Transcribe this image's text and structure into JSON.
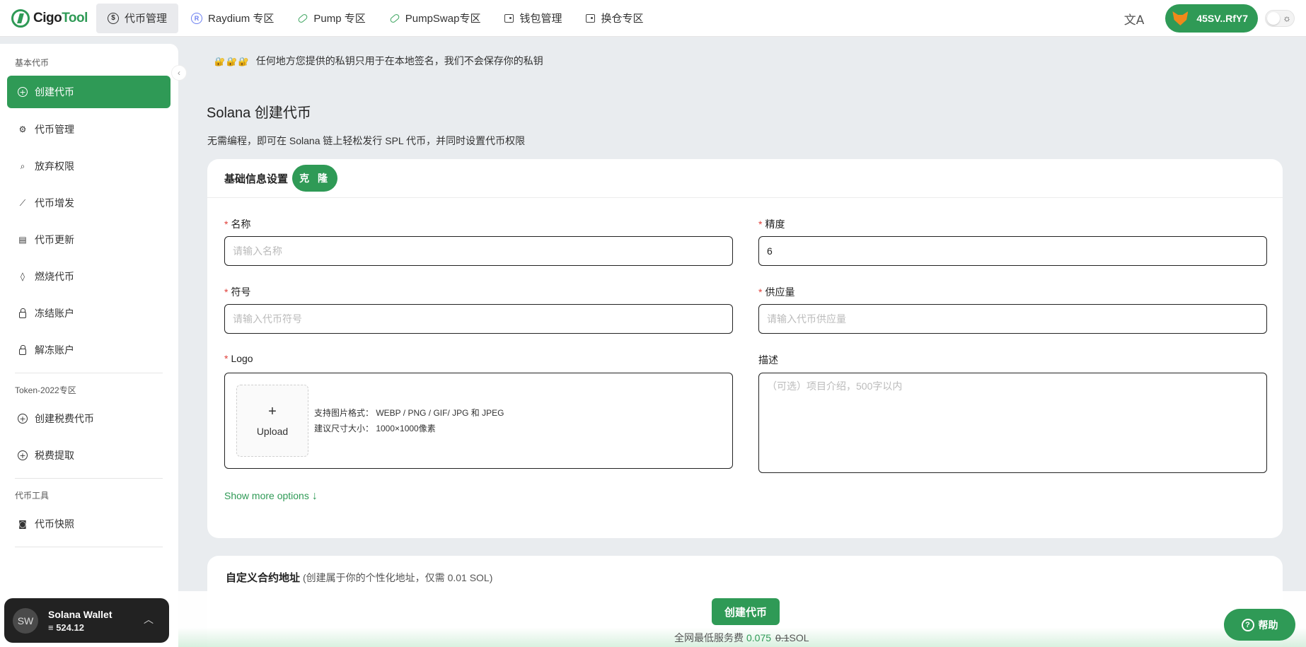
{
  "brand": {
    "name_a": "Cigo",
    "name_b": "Tool"
  },
  "nav": [
    {
      "label": "代币管理",
      "icon": "dollar-icon",
      "active": true
    },
    {
      "label": "Raydium 专区",
      "icon": "raydium-icon"
    },
    {
      "label": "Pump 专区",
      "icon": "pill-icon"
    },
    {
      "label": "PumpSwap专区",
      "icon": "pill-icon"
    },
    {
      "label": "钱包管理",
      "icon": "wallet-icon"
    },
    {
      "label": "换仓专区",
      "icon": "wallet-icon"
    }
  ],
  "header": {
    "wallet_address": "45SV..RfY7",
    "translate_glyph": "文A"
  },
  "sidebar": {
    "section_basic": "基本代币",
    "section_2022": "Token-2022专区",
    "section_tools": "代币工具",
    "items": [
      {
        "label": "创建代币",
        "icon": "plus-circle-icon",
        "active": true
      },
      {
        "label": "代币管理",
        "icon": "gears-icon"
      },
      {
        "label": "放弃权限",
        "icon": "search-icon"
      },
      {
        "label": "代币增发",
        "icon": "chart-line-icon"
      },
      {
        "label": "代币更新",
        "icon": "document-icon"
      },
      {
        "label": "燃烧代币",
        "icon": "flame-icon"
      },
      {
        "label": "冻结账户",
        "icon": "lock-icon"
      },
      {
        "label": "解冻账户",
        "icon": "unlock-icon"
      },
      {
        "label": "创建税费代币",
        "icon": "plus-circle-icon"
      },
      {
        "label": "税费提取",
        "icon": "plus-circle-icon"
      },
      {
        "label": "代币快照",
        "icon": "camera-icon"
      }
    ],
    "wallet": {
      "initials": "SW",
      "name": "Solana Wallet",
      "balance": "≡ 524.12"
    }
  },
  "main": {
    "notice": "任何地方您提供的私钥只用于在本地签名，我们不会保存你的私钥",
    "title": "Solana 创建代币",
    "description": "无需编程，即可在 Solana 链上轻松发行 SPL 代币，并同时设置代币权限",
    "basic_card": {
      "heading": "基础信息设置",
      "clone_label": "克 隆",
      "name_label": "名称",
      "name_placeholder": "请输入名称",
      "decimals_label": "精度",
      "decimals_value": "6",
      "symbol_label": "符号",
      "symbol_placeholder": "请输入代币符号",
      "supply_label": "供应量",
      "supply_placeholder": "请输入代币供应量",
      "logo_label": "Logo",
      "upload_label": "Upload",
      "format_hint": "支持图片格式： WEBP / PNG / GIF/ JPG 和 JPEG",
      "size_hint": "建议尺寸大小： 1000×1000像素",
      "desc_label": "描述",
      "desc_placeholder": "（可选）项目介绍，500字以内",
      "more_options": "Show more options"
    },
    "custom_card": {
      "heading": "自定义合约地址",
      "sub": "(创建属于你的个性化地址，仅需 0.01 SOL)"
    }
  },
  "action": {
    "create_label": "创建代币",
    "fee_prefix": "全网最低服务费",
    "fee_price": "0.075",
    "fee_old": "0.1",
    "fee_unit": "SOL"
  },
  "help": {
    "label": "帮助"
  },
  "colors": {
    "accent": "#2f9a56",
    "required": "#e0403a"
  }
}
